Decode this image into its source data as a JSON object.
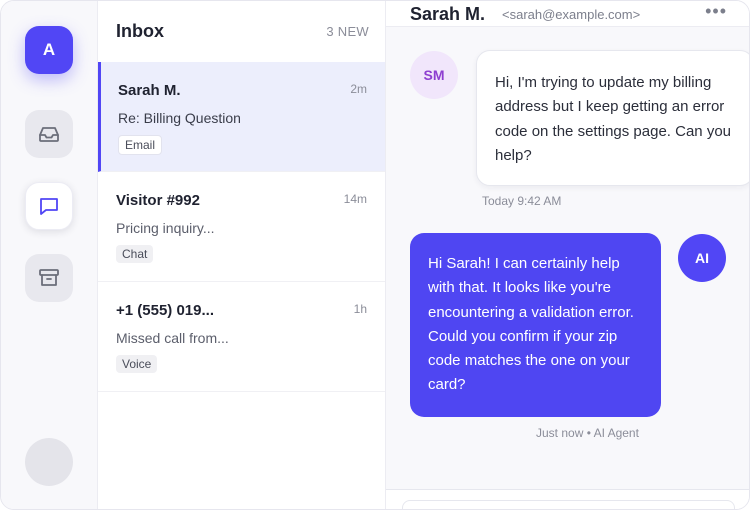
{
  "rail": {
    "brand_letter": "A",
    "items": [
      {
        "name": "inbox",
        "icon": "inbox-tray-icon"
      },
      {
        "name": "chat",
        "icon": "chat-bubble-icon",
        "active": true
      },
      {
        "name": "archive",
        "icon": "archive-box-icon"
      }
    ]
  },
  "list": {
    "title": "Inbox",
    "count": "3 NEW",
    "items": [
      {
        "name": "Sarah M.",
        "time": "2m",
        "snippet": "Re: Billing Question",
        "tag": "Email"
      },
      {
        "name": "Visitor #992",
        "time": "14m",
        "snippet": "Pricing inquiry...",
        "tag": "Chat"
      },
      {
        "name": "+1 (555) 019...",
        "time": "1h",
        "snippet": "Missed call from...",
        "tag": "Voice"
      }
    ]
  },
  "conversation": {
    "name": "Sarah M.",
    "email": "<sarah@example.com>",
    "more": "•••",
    "messages": [
      {
        "avatar": "SM",
        "text": "Hi, I'm trying to update my billing address but I keep getting an error code on the settings page. Can you help?",
        "meta": "Today 9:42 AM"
      },
      {
        "avatar": "AI",
        "text": "Hi Sarah! I can certainly help with that. It looks like you're encountering a validation error. Could you confirm if your zip code matches the one on your card?",
        "meta": "Just now • AI Agent"
      }
    ]
  },
  "colors": {
    "accent": "#5146f5",
    "bubble_out": "#4f46f2"
  }
}
